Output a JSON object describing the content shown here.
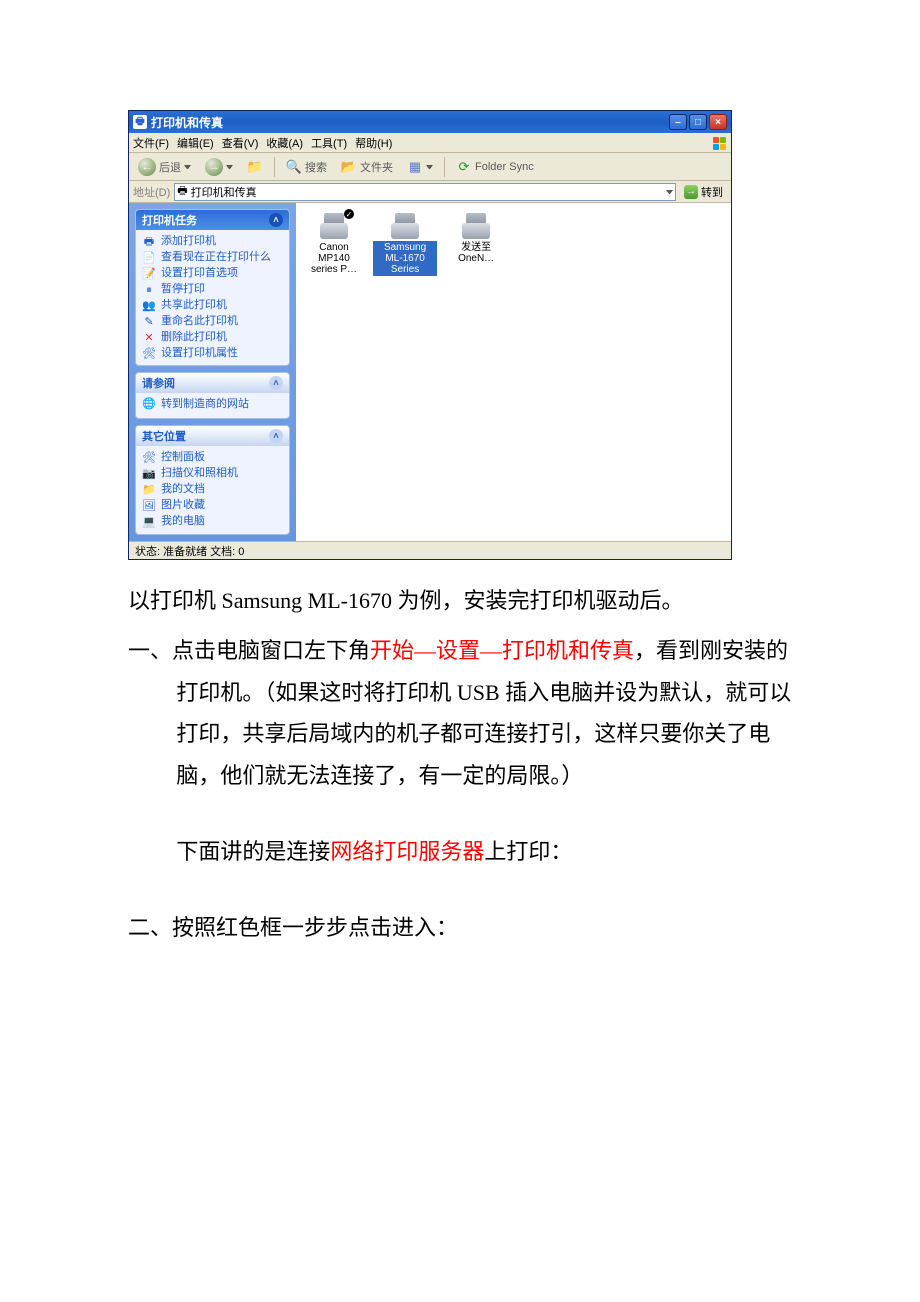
{
  "window": {
    "title": "打印机和传真",
    "menus": {
      "file": "文件(F)",
      "edit": "编辑(E)",
      "view": "查看(V)",
      "favorites": "收藏(A)",
      "tools": "工具(T)",
      "help": "帮助(H)"
    },
    "toolbar": {
      "back": "后退",
      "search": "搜索",
      "folders": "文件夹",
      "folder_sync": "Folder Sync"
    },
    "addressbar": {
      "label": "地址(D)",
      "value": "打印机和传真",
      "go": "转到"
    },
    "panels": {
      "tasks": {
        "title": "打印机任务",
        "items": [
          "添加打印机",
          "查看现在正在打印什么",
          "设置打印首选项",
          "暂停打印",
          "共享此打印机",
          "重命名此打印机",
          "删除此打印机",
          "设置打印机属性"
        ]
      },
      "see_also": {
        "title": "请参阅",
        "items": [
          "转到制造商的网站"
        ]
      },
      "other_places": {
        "title": "其它位置",
        "items": [
          "控制面板",
          "扫描仪和照相机",
          "我的文档",
          "图片收藏",
          "我的电脑"
        ]
      }
    },
    "printers": [
      {
        "label": "Canon MP140 series P…",
        "selected": false,
        "default": true
      },
      {
        "label": "Samsung ML-1670 Series",
        "selected": true,
        "default": false
      },
      {
        "label": "发送至 OneN…",
        "selected": false,
        "default": false
      }
    ],
    "statusbar": "状态: 准备就绪  文档: 0"
  },
  "doc": {
    "p1a": "以打印机 Samsung ML-1670 为例，安装完打印机驱动后。",
    "s1_num": "一、",
    "s1_a": "点击电脑窗口左下角",
    "s1_red": "开始—设置—打印机和传真",
    "s1_b": "，看到刚安装的打印机。（如果这时将打印机 USB 插入电脑并设为默认，就可以打印，共享后局域内的机子都可连接打引，这样只要你关了电脑，他们就无法连接了，有一定的局限。）",
    "s2_a": "下面讲的是连接",
    "s2_red": "网络打印服务器",
    "s2_b": "上打印：",
    "s3": "二、按照红色框一步步点击进入："
  }
}
